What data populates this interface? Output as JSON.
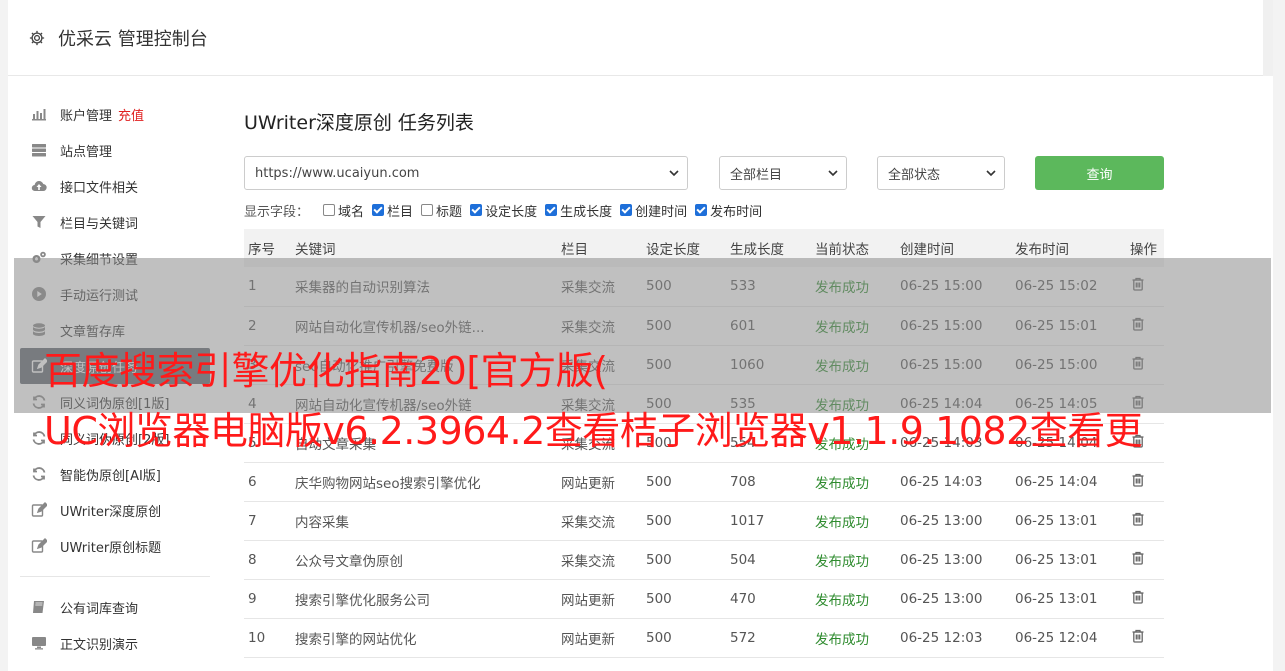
{
  "header": {
    "title": "优采云 管理控制台"
  },
  "sidebar": {
    "items": [
      {
        "label": "账户管理",
        "extra": "充值",
        "icon": "bar-chart-icon"
      },
      {
        "label": "站点管理",
        "icon": "server-icon"
      },
      {
        "label": "接口文件相关",
        "icon": "cloud-upload-icon"
      },
      {
        "label": "栏目与关键词",
        "icon": "filter-icon"
      },
      {
        "label": "采集细节设置",
        "icon": "gears-icon"
      },
      {
        "label": "手动运行测试",
        "icon": "play-circle-icon"
      },
      {
        "label": "文章暂存库",
        "icon": "database-icon"
      },
      {
        "label": "深度原创任务",
        "icon": "edit-icon",
        "active": true
      },
      {
        "label": "同义词伪原创[1版]",
        "icon": "refresh-icon"
      },
      {
        "label": "同义词伪原创[2版]",
        "icon": "refresh-icon"
      },
      {
        "label": "智能伪原创[AI版]",
        "icon": "refresh-icon"
      },
      {
        "label": "UWriter深度原创",
        "icon": "edit-icon"
      },
      {
        "label": "UWriter原创标题",
        "icon": "edit-icon"
      },
      {
        "label": "公有词库查询",
        "icon": "book-icon"
      },
      {
        "label": "正文识别演示",
        "icon": "monitor-icon"
      }
    ]
  },
  "main": {
    "title": "UWriter深度原创 任务列表",
    "filters": {
      "site": "https://www.ucaiyun.com",
      "column": "全部栏目",
      "status": "全部状态",
      "query_label": "查询"
    },
    "fields": {
      "label": "显示字段：",
      "options": [
        {
          "label": "域名",
          "checked": false
        },
        {
          "label": "栏目",
          "checked": true
        },
        {
          "label": "标题",
          "checked": false
        },
        {
          "label": "设定长度",
          "checked": true
        },
        {
          "label": "生成长度",
          "checked": true
        },
        {
          "label": "创建时间",
          "checked": true
        },
        {
          "label": "发布时间",
          "checked": true
        }
      ]
    },
    "table": {
      "headers": [
        "序号",
        "关键词",
        "栏目",
        "设定长度",
        "生成长度",
        "当前状态",
        "创建时间",
        "发布时间",
        "操作"
      ],
      "rows": [
        [
          "1",
          "采集器的自动识别算法",
          "采集交流",
          "500",
          "533",
          "发布成功",
          "06-25 15:00",
          "06-25 15:02"
        ],
        [
          "2",
          "网站自动化宣传机器/seo外链...",
          "采集交流",
          "500",
          "601",
          "发布成功",
          "06-25 15:00",
          "06-25 15:01"
        ],
        [
          "3",
          "seo自动化推广引擎免费版",
          "采集交流",
          "500",
          "1060",
          "发布成功",
          "06-25 15:00",
          "06-25 15:00"
        ],
        [
          "4",
          "网站自动化宣传机器/seo外链",
          "采集交流",
          "500",
          "535",
          "发布成功",
          "06-25 14:04",
          "06-25 14:05"
        ],
        [
          "5",
          "自动文章采集",
          "采集交流",
          "500",
          "554",
          "发布成功",
          "06-25 14:03",
          "06-25 14:04"
        ],
        [
          "6",
          "庆华购物网站seo搜索引擎优化",
          "网站更新",
          "500",
          "708",
          "发布成功",
          "06-25 14:03",
          "06-25 14:04"
        ],
        [
          "7",
          "内容采集",
          "采集交流",
          "500",
          "1017",
          "发布成功",
          "06-25 13:00",
          "06-25 13:01"
        ],
        [
          "8",
          "公众号文章伪原创",
          "采集交流",
          "500",
          "504",
          "发布成功",
          "06-25 13:00",
          "06-25 13:01"
        ],
        [
          "9",
          "搜索引擎优化服务公司",
          "网站更新",
          "500",
          "470",
          "发布成功",
          "06-25 13:00",
          "06-25 13:01"
        ],
        [
          "10",
          "搜索引擎的网站优化",
          "网站更新",
          "500",
          "572",
          "发布成功",
          "06-25 12:03",
          "06-25 12:04"
        ]
      ]
    }
  },
  "overlay": {
    "line1": "百度搜索引擎优化指南20[官方版(",
    "line2": "UC浏览器电脑版v6.2.3964.2查看桔子浏览器v1.1.9.1082查看更"
  },
  "colors": {
    "accent_green": "#5cb85c",
    "status_green": "#2e8b2e",
    "ad_red": "#ff1a1a",
    "recharge_red": "#e02020"
  }
}
